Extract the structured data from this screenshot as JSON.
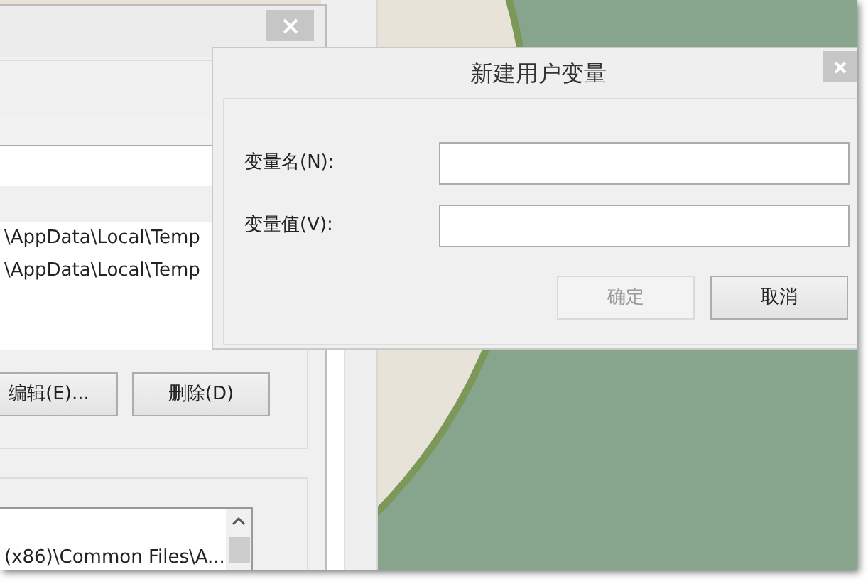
{
  "back_window": {
    "top_list": {
      "rows": [
        "\\AppData\\Local\\Temp",
        "\\AppData\\Local\\Temp"
      ]
    },
    "buttons": [
      {
        "label": "编辑(E)...",
        "disabled": false
      },
      {
        "label": "删除(D)",
        "disabled": false
      }
    ],
    "bottom_list": {
      "rows": [
        "(x86)\\Common Files\\A..."
      ]
    }
  },
  "dialog": {
    "title": "新建用户变量",
    "fields": [
      {
        "label": "变量名(N):"
      },
      {
        "label": "变量值(V):"
      }
    ],
    "buttons": [
      {
        "label": "确定",
        "disabled": true
      },
      {
        "label": "取消",
        "disabled": false
      }
    ]
  }
}
